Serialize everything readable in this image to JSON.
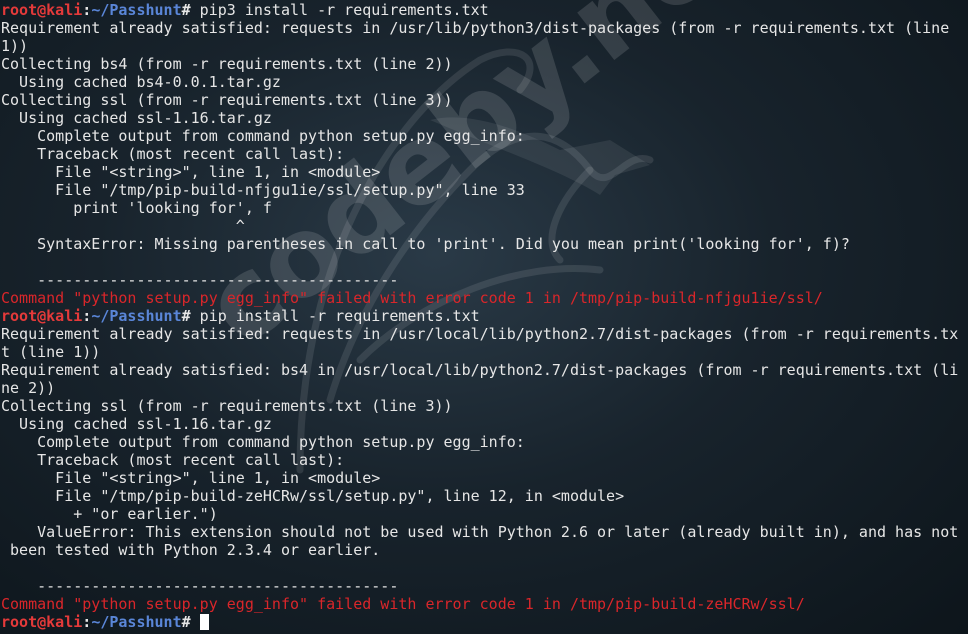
{
  "watermark": {
    "text": "codeby.net",
    "logo_icon": "kali-dragon-icon"
  },
  "colors": {
    "prompt_user": "#e53a3a",
    "prompt_path": "#5a86d8",
    "error_text": "#d9262a",
    "default_text": "#e6e6e6"
  },
  "prompt": {
    "user_host": "root@kali",
    "path": "~/Passhunt"
  },
  "terminal": {
    "lines": [
      {
        "kind": "prompt",
        "command": " pip3 install -r requirements.txt"
      },
      {
        "kind": "out",
        "text": "Requirement already satisfied: requests in /usr/lib/python3/dist-packages (from -r requirements.txt (line"
      },
      {
        "kind": "out",
        "text": "1))"
      },
      {
        "kind": "out",
        "text": "Collecting bs4 (from -r requirements.txt (line 2))"
      },
      {
        "kind": "out",
        "text": "  Using cached bs4-0.0.1.tar.gz"
      },
      {
        "kind": "out",
        "text": "Collecting ssl (from -r requirements.txt (line 3))"
      },
      {
        "kind": "out",
        "text": "  Using cached ssl-1.16.tar.gz"
      },
      {
        "kind": "out",
        "text": "    Complete output from command python setup.py egg_info:"
      },
      {
        "kind": "out",
        "text": "    Traceback (most recent call last):"
      },
      {
        "kind": "out",
        "text": "      File \"<string>\", line 1, in <module>"
      },
      {
        "kind": "out",
        "text": "      File \"/tmp/pip-build-nfjgu1ie/ssl/setup.py\", line 33"
      },
      {
        "kind": "out",
        "text": "        print 'looking for', f"
      },
      {
        "kind": "out",
        "text": "                          ^"
      },
      {
        "kind": "out",
        "text": "    SyntaxError: Missing parentheses in call to 'print'. Did you mean print('looking for', f)?"
      },
      {
        "kind": "out",
        "text": ""
      },
      {
        "kind": "out",
        "text": "    ----------------------------------------"
      },
      {
        "kind": "err",
        "text": "Command \"python setup.py egg_info\" failed with error code 1 in /tmp/pip-build-nfjgu1ie/ssl/"
      },
      {
        "kind": "prompt",
        "command": " pip install -r requirements.txt"
      },
      {
        "kind": "out",
        "text": "Requirement already satisfied: requests in /usr/local/lib/python2.7/dist-packages (from -r requirements.tx"
      },
      {
        "kind": "out",
        "text": "t (line 1))"
      },
      {
        "kind": "out",
        "text": "Requirement already satisfied: bs4 in /usr/local/lib/python2.7/dist-packages (from -r requirements.txt (li"
      },
      {
        "kind": "out",
        "text": "ne 2))"
      },
      {
        "kind": "out",
        "text": "Collecting ssl (from -r requirements.txt (line 3))"
      },
      {
        "kind": "out",
        "text": "  Using cached ssl-1.16.tar.gz"
      },
      {
        "kind": "out",
        "text": "    Complete output from command python setup.py egg_info:"
      },
      {
        "kind": "out",
        "text": "    Traceback (most recent call last):"
      },
      {
        "kind": "out",
        "text": "      File \"<string>\", line 1, in <module>"
      },
      {
        "kind": "out",
        "text": "      File \"/tmp/pip-build-zeHCRw/ssl/setup.py\", line 12, in <module>"
      },
      {
        "kind": "out",
        "text": "        + \"or earlier.\")"
      },
      {
        "kind": "out",
        "text": "    ValueError: This extension should not be used with Python 2.6 or later (already built in), and has not"
      },
      {
        "kind": "out",
        "text": " been tested with Python 2.3.4 or earlier."
      },
      {
        "kind": "out",
        "text": ""
      },
      {
        "kind": "out",
        "text": "    ----------------------------------------"
      },
      {
        "kind": "err",
        "text": "Command \"python setup.py egg_info\" failed with error code 1 in /tmp/pip-build-zeHCRw/ssl/"
      },
      {
        "kind": "prompt",
        "command": " ",
        "cursor": true
      }
    ]
  }
}
